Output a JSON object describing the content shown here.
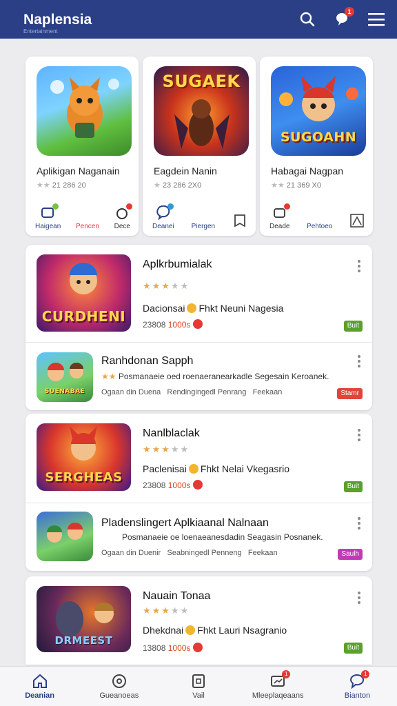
{
  "header": {
    "title": "Naplensia",
    "subtitle": "Entertainment",
    "notification_count": "1",
    "accent": "#2a3f86"
  },
  "featured": [
    {
      "title": "Aplikigan Naganain",
      "meta": "21 286 20",
      "actions": [
        "Haigean",
        "Pencen",
        "Dece"
      ],
      "thumb_text": ""
    },
    {
      "title": "Eagdein Nanin",
      "meta": "23 286 2X0",
      "actions": [
        "Deanei",
        "Piergen",
        ""
      ],
      "thumb_text": "SUGAEK"
    },
    {
      "title": "Habagai Nagpan",
      "meta": "21 369 X0",
      "actions": [
        "Deade",
        "Pehtoeo",
        ""
      ],
      "thumb_text": "SUGOAHN"
    }
  ],
  "list": [
    {
      "title": "Aplkrbumialak",
      "rating": 3,
      "desc_left": "Dacionsai",
      "desc_right": "Fhkt Neuni Nagesia",
      "size": "23808",
      "size_extra": "1000s",
      "badge": "Buit",
      "badge_color": "#5aa02c",
      "thumb_text": "CURDHENI"
    },
    {
      "title": "Ranhdonan Sapph",
      "desc": "Posmanaeie oed roenaeranearkadle Segesain Keroanek.",
      "sub_left": "Ogaan din Duena",
      "sub_mid": "Rendingingedl Penrang",
      "sub_right": "Feekaan",
      "badge": "Stamr",
      "badge_color": "#e0453b",
      "thumb_text": "SUENABAE"
    },
    {
      "title": "Nanlblaclak",
      "rating": 3,
      "desc_left": "Paclenisai",
      "desc_right": "Fhkt Nelai Vkegasrio",
      "size": "23808",
      "size_extra": "1000s",
      "badge": "Buit",
      "badge_color": "#5aa02c",
      "thumb_text": "SERGHEAS"
    },
    {
      "title": "Pladenslingert Aplkiaanal Nalnaan",
      "desc": "Posmanaeie oe loenaeanesdadin Seagasin Posnanek.",
      "sub_left": "Ogaan din Duenir",
      "sub_mid": "Seabningedl Penneng",
      "sub_right": "Feekaan",
      "badge": "Saulh",
      "badge_color": "#c13ab5",
      "thumb_text": ""
    },
    {
      "title": "Nauain Tonaa",
      "rating": 3,
      "desc_left": "Dhekdnai",
      "desc_right": "Fhkt Lauri Nsagranio",
      "size": "13808",
      "size_extra": "1000s",
      "badge": "Buit",
      "badge_color": "#5aa02c",
      "thumb_text": "DRMEEST"
    }
  ],
  "bottom_nav": [
    {
      "label": "Deanian",
      "active": true,
      "badge": ""
    },
    {
      "label": "Gueanoeas",
      "active": false,
      "badge": ""
    },
    {
      "label": "Vail",
      "active": false,
      "badge": ""
    },
    {
      "label": "Mleeplaqeaans",
      "active": false,
      "badge": "1"
    },
    {
      "label": "Bianton",
      "active": false,
      "badge": "1"
    }
  ]
}
